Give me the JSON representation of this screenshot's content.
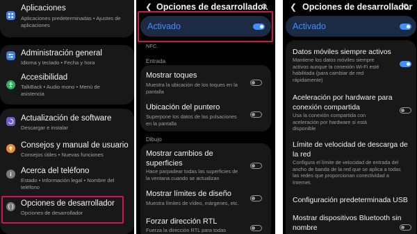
{
  "panel1": {
    "items": [
      {
        "title": "Aplicaciones",
        "subtitle": "Aplicaciones predeterminadas  •  Ajustes de aplicaciones"
      },
      {
        "title": "Administración general",
        "subtitle": "Idioma y teclado  •  Fecha y hora"
      },
      {
        "title": "Accesibilidad",
        "subtitle": "TalkBack  •  Audio mono  •  Menú de asistencia"
      },
      {
        "title": "Actualización de software",
        "subtitle": "Descargar e instalar"
      },
      {
        "title": "Consejos y manual de usuario",
        "subtitle": "Consejos útiles  •  Nuevas funciones"
      },
      {
        "title": "Acerca del teléfono",
        "subtitle": "Estado  •  Información legal  •  Nombre del teléfono"
      },
      {
        "title": "Opciones de desarrollador",
        "subtitle": "Opciones de desarrollador"
      }
    ],
    "colors": {
      "apps": "#3e7bf0",
      "admin": "#3e7bf0",
      "access": "#2fae5f",
      "update": "#6a5bd8",
      "tips": "#f08a2c",
      "about": "#7a7a7a",
      "dev": "#7a7a7a",
      "highlight": "#d4145a"
    },
    "icons": [
      "apps-grid-icon",
      "sliders-icon",
      "accessibility-icon",
      "update-icon",
      "tips-bulb-icon",
      "info-icon",
      "developer-braces-icon"
    ]
  },
  "panel2": {
    "header": {
      "title": "Opciones de desarrollador"
    },
    "master": {
      "label": "Activado",
      "on": true
    },
    "nfc_fragment": "NFC.",
    "section_entrada": "Entrada",
    "section_dibujo": "Dibujo",
    "items": [
      {
        "title": "Mostrar toques",
        "subtitle": "Muestra la ubicación de los toques en la pantalla",
        "on": false
      },
      {
        "title": "Ubicación del puntero",
        "subtitle": "Superpone los datos de las pulsaciones en la pantalla",
        "on": false
      },
      {
        "title": "Mostrar cambios de superficies",
        "subtitle": "Hace parpadear todas las superficies de la ventana cuando se actualizan",
        "on": false
      },
      {
        "title": "Mostrar límites de diseño",
        "subtitle": "Muestra límites de vídeo, márgenes, etc.",
        "on": false
      },
      {
        "title": "Forzar dirección RTL",
        "subtitle": "Fuerza la dirección RTL para todas",
        "on": false
      }
    ]
  },
  "panel3": {
    "header": {
      "title": "Opciones de desarrollador"
    },
    "master": {
      "label": "Activado",
      "on": true
    },
    "items": [
      {
        "title": "Datos móviles siempre activos",
        "subtitle": "Mantiene los datos móviles siempre activos aunque la conexión Wi-Fi esté habilitada (para cambiar de red rápidamente)",
        "on": true
      },
      {
        "title": "Aceleración por hardware para conexión compartida",
        "subtitle": "Usa la conexión compartida con aceleración por hardware si está disponible",
        "on": false
      },
      {
        "title": "Límite de velocidad de descarga de la red",
        "subtitle": "Configura el límite de velocidad de entrada del ancho de banda de la red que se aplica a todas las redes que proporcionan conectividad a Internet."
      },
      {
        "title": "Configuración predeterminada USB"
      },
      {
        "title": "Mostrar dispositivos Bluetooth sin nombre",
        "subtitle": "",
        "on": false
      }
    ]
  }
}
